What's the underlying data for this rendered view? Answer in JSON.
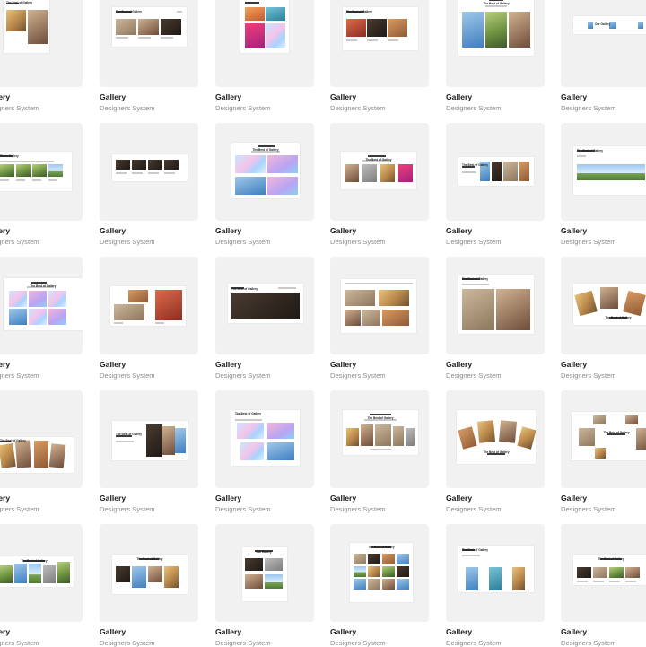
{
  "colors": {
    "card_background": "#f1f1f1",
    "title": "#1b1b1b",
    "subtitle": "#8b8b8b",
    "accent": "#5b9bf0"
  },
  "cards": [
    {
      "title": "Gallery",
      "subtitle": "Designers System",
      "preview": {
        "heading": "The Best of Gallery"
      }
    },
    {
      "title": "Gallery",
      "subtitle": "Designers System",
      "preview": {
        "heading": "The Best of Gallery"
      }
    },
    {
      "title": "Gallery",
      "subtitle": "Designers System",
      "preview": {
        "heading": ""
      }
    },
    {
      "title": "Gallery",
      "subtitle": "Designers System",
      "preview": {
        "heading": "The Best of Gallery"
      }
    },
    {
      "title": "Gallery",
      "subtitle": "Designers System",
      "preview": {
        "heading": "The Best of Gallery"
      }
    },
    {
      "title": "Gallery",
      "subtitle": "Designers System",
      "preview": {
        "heading": "Our Gallery"
      }
    },
    {
      "title": "Gallery",
      "subtitle": "Designers System",
      "preview": {
        "heading": "Photo Gallery"
      }
    },
    {
      "title": "Gallery",
      "subtitle": "Designers System",
      "preview": {
        "heading": ""
      }
    },
    {
      "title": "Gallery",
      "subtitle": "Designers System",
      "preview": {
        "heading": "The Best of Gallery"
      }
    },
    {
      "title": "Gallery",
      "subtitle": "Designers System",
      "preview": {
        "heading": "The Best of Gallery"
      }
    },
    {
      "title": "Gallery",
      "subtitle": "Designers System",
      "preview": {
        "heading": "The Best of Gallery"
      }
    },
    {
      "title": "Gallery",
      "subtitle": "Designers System",
      "preview": {
        "heading": "The Best of Gallery"
      }
    },
    {
      "title": "Gallery",
      "subtitle": "Designers System",
      "preview": {
        "heading": "The Best of Gallery"
      }
    },
    {
      "title": "Gallery",
      "subtitle": "Designers System",
      "preview": {
        "heading": ""
      }
    },
    {
      "title": "Gallery",
      "subtitle": "Designers System",
      "preview": {
        "heading": "The Best of Gallery"
      }
    },
    {
      "title": "Gallery",
      "subtitle": "Designers System",
      "preview": {
        "heading": ""
      }
    },
    {
      "title": "Gallery",
      "subtitle": "Designers System",
      "preview": {
        "heading": "The Best of Gallery"
      }
    },
    {
      "title": "Gallery",
      "subtitle": "Designers System",
      "preview": {
        "heading": "The Best of Gallery"
      }
    },
    {
      "title": "Gallery",
      "subtitle": "Designers System",
      "preview": {
        "heading": "The Best of Gallery"
      }
    },
    {
      "title": "Gallery",
      "subtitle": "Designers System",
      "preview": {
        "heading": "The Best of Gallery"
      }
    },
    {
      "title": "Gallery",
      "subtitle": "Designers System",
      "preview": {
        "heading": "The Best of Gallery"
      }
    },
    {
      "title": "Gallery",
      "subtitle": "Designers System",
      "preview": {
        "heading": "The Best of Gallery"
      }
    },
    {
      "title": "Gallery",
      "subtitle": "Designers System",
      "preview": {
        "heading": "The Best of Gallery"
      }
    },
    {
      "title": "Gallery",
      "subtitle": "Designers System",
      "preview": {
        "heading": "The Best of Gallery"
      }
    },
    {
      "title": "Gallery",
      "subtitle": "Designers System",
      "preview": {
        "heading": "The Best of Gallery"
      }
    },
    {
      "title": "Gallery",
      "subtitle": "Designers System",
      "preview": {
        "heading": "The Best of Gallery"
      }
    },
    {
      "title": "Gallery",
      "subtitle": "Designers System",
      "preview": {
        "heading": "Our Gallery"
      }
    },
    {
      "title": "Gallery",
      "subtitle": "Designers System",
      "preview": {
        "heading": "The Best of Gallery"
      }
    },
    {
      "title": "Gallery",
      "subtitle": "Designers System",
      "preview": {
        "heading": "The Best of Gallery"
      }
    },
    {
      "title": "Gallery",
      "subtitle": "Designers System",
      "preview": {
        "heading": "The Best of Gallery"
      }
    }
  ]
}
